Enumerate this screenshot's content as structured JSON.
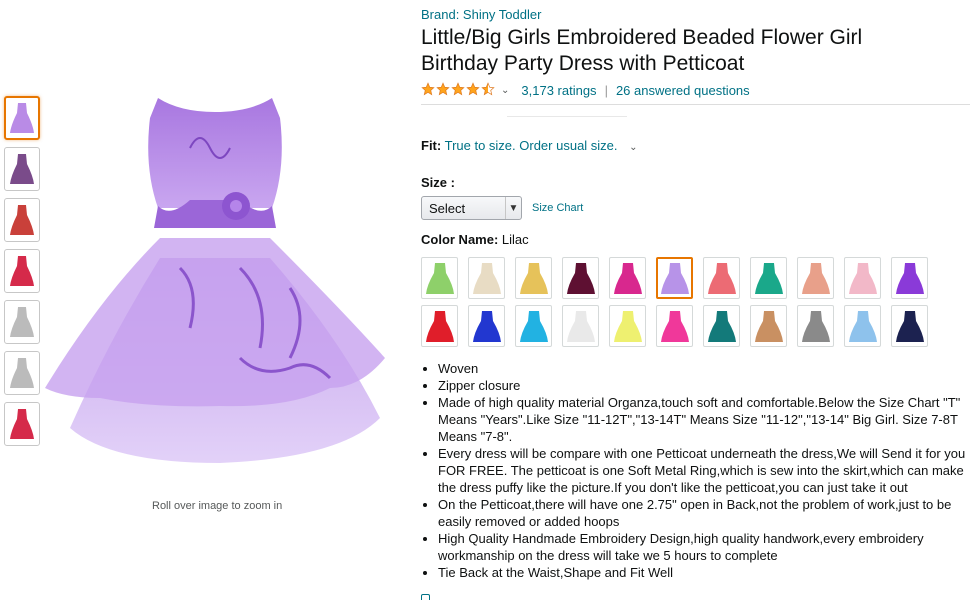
{
  "gallery": {
    "zoom_hint": "Roll over image to zoom in",
    "thumbnails": [
      {
        "name": "thumb-lilac-dress",
        "color": "#b98be6",
        "active": true
      },
      {
        "name": "thumb-model-photo",
        "color": "#7a4b8a",
        "active": false
      },
      {
        "name": "thumb-color-collage",
        "color": "#c9403a",
        "active": false
      },
      {
        "name": "thumb-red-dress",
        "color": "#d52a4a",
        "active": false
      },
      {
        "name": "thumb-size-chart-1",
        "color": "#bbbbbb",
        "active": false
      },
      {
        "name": "thumb-size-chart-2",
        "color": "#bbbbbb",
        "active": false
      },
      {
        "name": "thumb-red-dress-back",
        "color": "#d52a4a",
        "active": false
      }
    ]
  },
  "product": {
    "brand": "Brand: Shiny Toddler",
    "title": "Little/Big Girls Embroidered Beaded Flower Girl Birthday Party Dress with Petticoat",
    "rating_value": 4.5,
    "ratings": "3,173 ratings",
    "separator": "|",
    "answered": "26 answered questions"
  },
  "fit": {
    "label": "Fit:",
    "value": "True to size. Order usual size."
  },
  "size": {
    "label": "Size :",
    "selected": "Select",
    "chart_link": "Size Chart"
  },
  "color": {
    "label": "Color Name:",
    "value": "Lilac",
    "swatches": [
      {
        "name": "green",
        "hex": "#8ed06a"
      },
      {
        "name": "champagne",
        "hex": "#e8dcc4"
      },
      {
        "name": "gold",
        "hex": "#e6c25a"
      },
      {
        "name": "burgundy",
        "hex": "#5e1032"
      },
      {
        "name": "magenta",
        "hex": "#d8288e"
      },
      {
        "name": "lilac",
        "hex": "#b793e8",
        "selected": true
      },
      {
        "name": "coral",
        "hex": "#ec6b74"
      },
      {
        "name": "teal",
        "hex": "#1aa88a"
      },
      {
        "name": "peach",
        "hex": "#e8a08a"
      },
      {
        "name": "pink",
        "hex": "#f2b8c8"
      },
      {
        "name": "purple",
        "hex": "#8a3ad8"
      },
      {
        "name": "red",
        "hex": "#e01e2a"
      },
      {
        "name": "royal-blue",
        "hex": "#2237d0"
      },
      {
        "name": "turquoise",
        "hex": "#22b2e2"
      },
      {
        "name": "white",
        "hex": "#e9e9e9"
      },
      {
        "name": "yellow",
        "hex": "#eef070"
      },
      {
        "name": "hot-pink",
        "hex": "#f0389a"
      },
      {
        "name": "dark-teal",
        "hex": "#137a7a"
      },
      {
        "name": "bronze",
        "hex": "#c99062"
      },
      {
        "name": "gray",
        "hex": "#8a8a8a"
      },
      {
        "name": "light-blue",
        "hex": "#8ec2ec"
      },
      {
        "name": "navy",
        "hex": "#1c2250"
      }
    ]
  },
  "bullets": [
    "Woven",
    "Zipper closure",
    "Made of high quality material Organza,touch soft and comfortable.Below the Size Chart \"T\" Means \"Years\".Like Size \"11-12T\",\"13-14T\" Means Size \"11-12\",\"13-14\" Big Girl. Size 7-8T Means \"7-8\".",
    "Every dress will be compare with one Petticoat underneath the dress,We will Send it for you FOR FREE. The petticoat is one Soft Metal Ring,which is sew into the skirt,which can make the dress puffy like the picture.If you don't like the petticoat,you can just take it out",
    "On the Petticoat,there will have one 2.75\" open in Back,not the problem of work,just to be easily removed or added hoops",
    "High Quality Handmade Embroidery Design,high quality handwork,every embroidery workmanship on the dress will take we 5 hours to complete",
    "Tie Back at the Waist,Shape and Fit Well"
  ],
  "colors": {
    "link": "#007185",
    "star": "#ffa41c",
    "selected_border": "#e77600"
  }
}
